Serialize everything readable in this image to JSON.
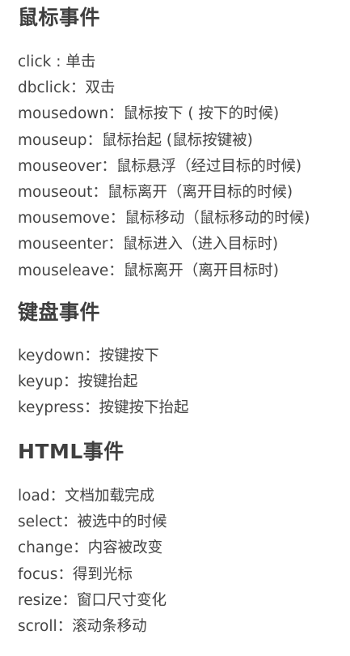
{
  "sections": [
    {
      "heading": "鼠标事件",
      "items": [
        "click : 单击",
        "dbclick：双击",
        "mousedown：鼠标按下 ( 按下的时候)",
        "mouseup：鼠标抬起 (鼠标按键被)",
        "mouseover：鼠标悬浮（经过目标的时候)",
        "mouseout：鼠标离开（离开目标的时候)",
        "mousemove：鼠标移动（鼠标移动的时候)",
        "mouseenter：鼠标进入（进入目标时)",
        "mouseleave：鼠标离开（离开目标时)"
      ]
    },
    {
      "heading": "键盘事件",
      "items": [
        "keydown：按键按下",
        "keyup：按键抬起",
        "keypress：按键按下抬起"
      ]
    },
    {
      "heading": "HTML事件",
      "items": [
        "load：文档加载完成",
        "select：被选中的时候",
        "change：内容被改变",
        "focus：得到光标",
        "resize：窗口尺寸变化",
        "scroll：滚动条移动"
      ]
    }
  ]
}
